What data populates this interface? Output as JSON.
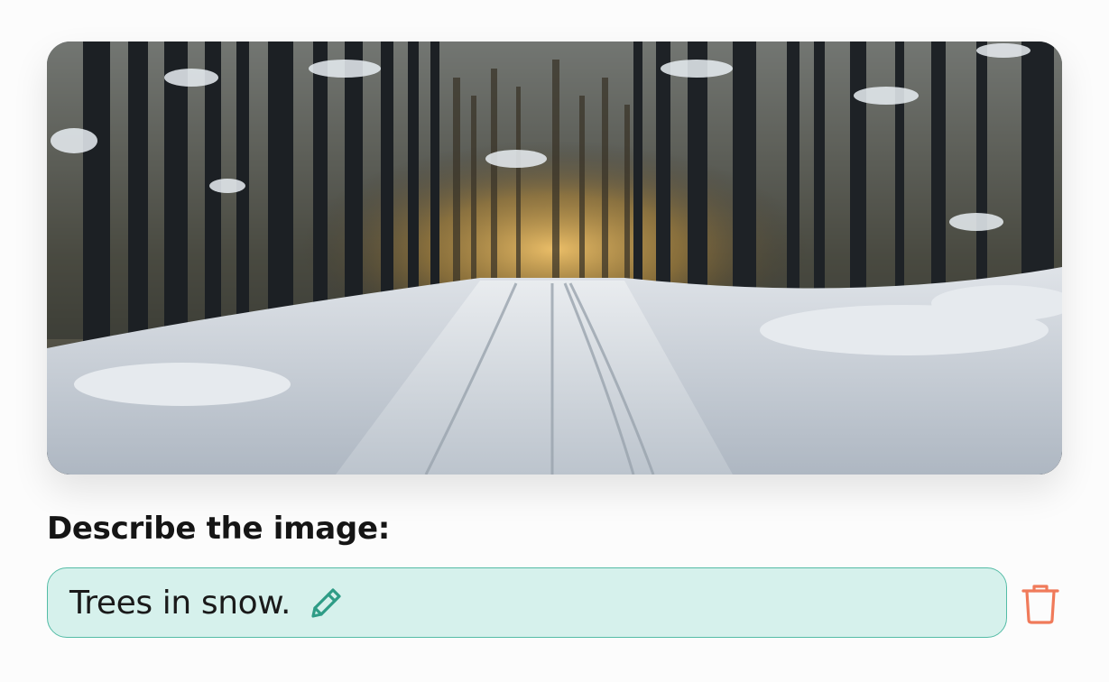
{
  "image": {
    "icon": "snowy-forest-road-photo"
  },
  "prompt": {
    "label": "Describe the image:"
  },
  "answer": {
    "value": "Trees in snow.",
    "field_bg": "#d6f1ec",
    "field_border": "#54bca6"
  },
  "actions": {
    "edit_icon": "pencil-icon",
    "delete_icon": "trash-icon",
    "edit_color": "#2e9c86",
    "delete_color": "#f07a5a"
  }
}
